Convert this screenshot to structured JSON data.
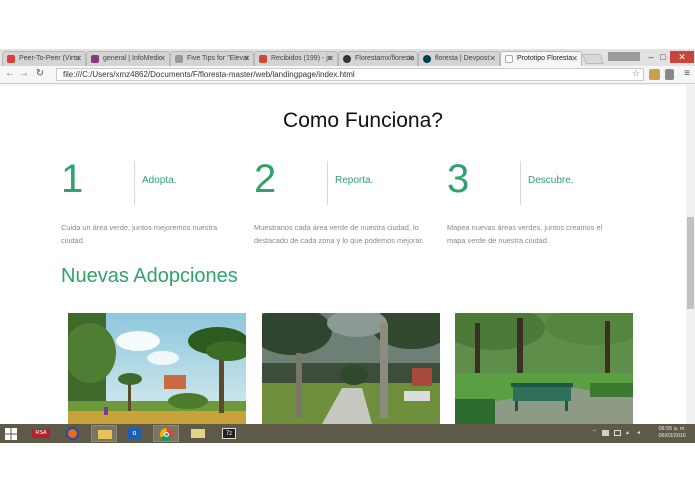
{
  "browser": {
    "tabs": [
      {
        "title": "Peer-To-Peer (Virtu",
        "color": "#e03a3a"
      },
      {
        "title": "general | InfoMedic",
        "color": "#8a3a7a"
      },
      {
        "title": "Five Tips for \"Elevat",
        "color": "#777777"
      },
      {
        "title": "Recibidos (199) - jo",
        "color": "#d44638"
      },
      {
        "title": "Florestamx/floresta",
        "color": "#333333"
      },
      {
        "title": "floresta | Devpost",
        "color": "#003e54"
      },
      {
        "title": "Prototipo Floresta",
        "color": "#ffffff"
      }
    ],
    "url": "file:///C:/Users/xmz4862/Documents/F/floresta-master/web/landingpage/index.html",
    "user_chip": "",
    "window_buttons": {
      "minimize": "–",
      "maximize": "□",
      "close": "✕"
    }
  },
  "page": {
    "headline": "Como Funciona?",
    "steps": [
      {
        "number": "1",
        "label": "Adopta.",
        "description": "Cuida un área verde, juntos mejoremos nuestra ciudad."
      },
      {
        "number": "2",
        "label": "Reporta.",
        "description": "Muestranos cada área verde de nuestra ciudad, lo destacado de cada zona y lo que podemos mejorar."
      },
      {
        "number": "3",
        "label": "Descubre.",
        "description": "Mapea nuevas áreas verdes, juntos creamos el mapa verde de nuestra ciudad."
      }
    ],
    "section_title": "Nuevas Adopciones",
    "accent_color": "#2fa36b"
  },
  "taskbar": {
    "items": [
      "start",
      "rsa-app",
      "firefox",
      "file-explorer",
      "outlook",
      "chrome",
      "folder",
      "7zip"
    ],
    "rsa_label": "RSA",
    "zip_label": "7z",
    "time": "08:55 a. m.",
    "date": "06/03/2016"
  }
}
